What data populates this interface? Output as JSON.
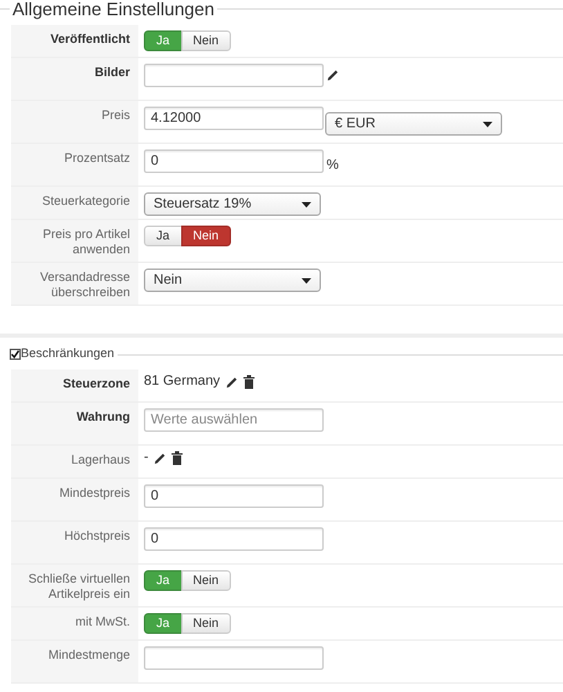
{
  "sections": [
    {
      "kind": "heading",
      "title": "Allgemeine Einstellungen",
      "rows": [
        {
          "kind": "toggle",
          "label": "Veröffentlicht",
          "emphasized": true,
          "options": [
            {
              "label": "Ja",
              "selected": true
            },
            {
              "label": "Nein",
              "selected": false
            }
          ]
        },
        {
          "kind": "image_input",
          "label": "Bilder",
          "emphasized": true
        },
        {
          "kind": "input_select",
          "label": "Preis",
          "emphasized": false,
          "value": "4.12000",
          "select": "€ EUR"
        },
        {
          "kind": "input",
          "label": "Prozentsatz",
          "emphasized": false,
          "value": "0",
          "suffix": "%"
        },
        {
          "kind": "select",
          "label": "Steuerkategorie",
          "emphasized": false,
          "value": "Steuersatz 19%"
        },
        {
          "kind": "toggle",
          "label": "Preis pro Artikel anwenden",
          "emphasized": false,
          "options": [
            {
              "label": "Ja",
              "selected": false
            },
            {
              "label": "Nein",
              "selected": true
            }
          ]
        },
        {
          "kind": "select",
          "label": "Versandadresse überschreiben",
          "emphasized": false,
          "value": "Nein"
        }
      ]
    },
    {
      "kind": "checkbox",
      "title": "Beschränkungen",
      "checked": true,
      "rows": [
        {
          "kind": "display",
          "label": "Steuerzone",
          "emphasized": true,
          "value": "81 Germany"
        },
        {
          "kind": "input",
          "label": "Wahrung",
          "emphasized": true,
          "placeholder": "Werte auswählen"
        },
        {
          "kind": "display",
          "label": "Lagerhaus",
          "emphasized": false,
          "value": "-"
        },
        {
          "kind": "input",
          "label": "Mindestpreis",
          "emphasized": false,
          "value": "0"
        },
        {
          "kind": "input",
          "label": "Höchstpreis",
          "emphasized": false,
          "value": "0"
        },
        {
          "kind": "toggle",
          "label": "Schließe virtuellen Artikelpreis ein",
          "emphasized": false,
          "options": [
            {
              "label": "Ja",
              "selected": true
            },
            {
              "label": "Nein",
              "selected": false
            }
          ]
        },
        {
          "kind": "toggle",
          "label": "mit MwSt.",
          "emphasized": false,
          "options": [
            {
              "label": "Ja",
              "selected": true
            },
            {
              "label": "Nein",
              "selected": false
            }
          ]
        },
        {
          "kind": "input",
          "label": "Mindestmenge",
          "emphasized": false
        }
      ]
    }
  ]
}
